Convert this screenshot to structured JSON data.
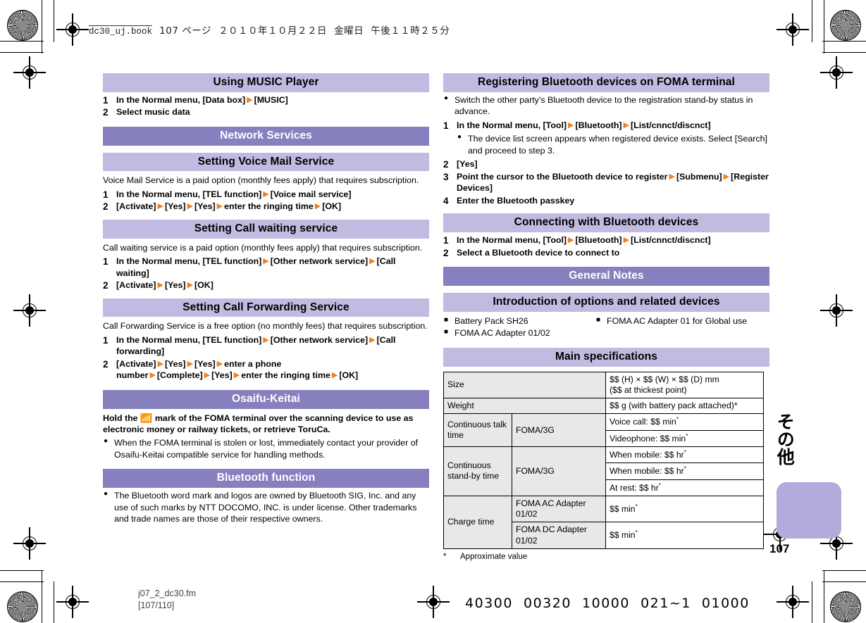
{
  "running_header": {
    "file": "dc30_uj.book",
    "page_label": "107 ページ",
    "date": "２０１０年１０月２２日",
    "weekday": "金曜日",
    "time": "午後１１時２５分"
  },
  "colors": {
    "header_light": "#c2bae0",
    "header_dark": "#8780bf",
    "arrow_orange": "#f08020",
    "table_label_bg": "#e8e8e8",
    "thumb_tab": "#b4aadc"
  },
  "left_column": {
    "music": {
      "heading": "Using MUSIC Player",
      "steps": [
        {
          "num": "1",
          "parts": [
            "In the Normal menu, [Data box]",
            "[MUSIC]"
          ]
        },
        {
          "num": "2",
          "parts": [
            "Select music data"
          ]
        }
      ]
    },
    "network_services_heading": "Network Services",
    "voice_mail": {
      "heading": "Setting Voice Mail Service",
      "note": "Voice Mail Service is a paid option (monthly fees apply) that requires subscription.",
      "steps": [
        {
          "num": "1",
          "parts": [
            "In the Normal menu, [TEL function]",
            "[Voice mail service]"
          ]
        },
        {
          "num": "2",
          "parts": [
            "[Activate]",
            "[Yes]",
            "[Yes]",
            "enter the ringing time",
            "[OK]"
          ]
        }
      ]
    },
    "call_waiting": {
      "heading": "Setting Call waiting service",
      "note": "Call waiting service is a paid option (monthly fees apply) that requires subscription.",
      "steps": [
        {
          "num": "1",
          "parts": [
            "In the Normal menu, [TEL function]",
            "[Other network service]",
            "[Call waiting]"
          ]
        },
        {
          "num": "2",
          "parts": [
            "[Activate]",
            "[Yes]",
            "[OK]"
          ]
        }
      ]
    },
    "call_forwarding": {
      "heading": "Setting Call Forwarding Service",
      "note": "Call Forwarding Service is a free option (no monthly fees) that requires subscription.",
      "steps": [
        {
          "num": "1",
          "parts": [
            "In the Normal menu, [TEL function]",
            "[Other network service]",
            "[Call forwarding]"
          ]
        },
        {
          "num": "2",
          "parts": [
            "[Activate]",
            "[Yes]",
            "[Yes]",
            "enter a phone number",
            "[Complete]",
            "[Yes]",
            "enter the ringing time",
            "[OK]"
          ]
        }
      ]
    },
    "osaifu": {
      "heading": "Osaifu-Keitai",
      "lead_before": "Hold the",
      "mark_icon": "felica-mark-icon",
      "lead_after": "mark of the FOMA terminal over the scanning device to use as electronic money or railway tickets, or retrieve ToruCa.",
      "bullets": [
        "When the FOMA terminal is stolen or lost, immediately contact your provider of Osaifu-Keitai compatible service for handling methods."
      ]
    },
    "bluetooth": {
      "heading": "Bluetooth function",
      "bullets": [
        "The Bluetooth word mark and logos are owned by Bluetooth SIG, Inc. and any use of such marks by NTT DOCOMO, INC. is under license. Other trademarks and trade names are those of their respective owners."
      ]
    }
  },
  "right_column": {
    "registering": {
      "heading": "Registering Bluetooth devices on FOMA terminal",
      "bullets": [
        "Switch the other party’s Bluetooth device to the registration stand-by status in advance."
      ],
      "steps": [
        {
          "num": "1",
          "parts": [
            "In the Normal menu, [Tool]",
            "[Bluetooth]",
            "[List/cnnct/discnct]"
          ],
          "subbullets": [
            "The device list screen appears when registered device exists. Select [Search] and proceed to step 3."
          ]
        },
        {
          "num": "2",
          "parts": [
            "[Yes]"
          ]
        },
        {
          "num": "3",
          "parts": [
            "Point the cursor to the Bluetooth device to register",
            "[Submenu]",
            "[Register Devices]"
          ]
        },
        {
          "num": "4",
          "parts": [
            "Enter the Bluetooth passkey"
          ]
        }
      ]
    },
    "connecting": {
      "heading": "Connecting with Bluetooth devices",
      "steps": [
        {
          "num": "1",
          "parts": [
            "In the Normal menu, [Tool]",
            "[Bluetooth]",
            "[List/cnnct/discnct]"
          ]
        },
        {
          "num": "2",
          "parts": [
            "Select a Bluetooth device to connect to"
          ]
        }
      ]
    },
    "general_notes_heading": "General Notes",
    "options": {
      "heading": "Introduction of options and related devices",
      "col1": [
        "Battery Pack SH26",
        "FOMA AC Adapter 01/02"
      ],
      "col2": [
        "FOMA AC Adapter 01 for Global use"
      ]
    },
    "specs": {
      "heading": "Main specifications",
      "rows": [
        {
          "label": "Size",
          "sub": null,
          "values": [
            "$$ (H) × $$ (W) × $$ (D) mm",
            "($$ at thickest point)"
          ]
        },
        {
          "label": "Weight",
          "sub": null,
          "values": [
            "$$ g (with battery pack attached)*"
          ]
        },
        {
          "label": "Continuous talk time",
          "sub": "FOMA/3G",
          "values": [
            "Voice call: $$ min*",
            "Videophone: $$ min*"
          ]
        },
        {
          "label": "Continuous stand-by time",
          "sub": "FOMA/3G",
          "values": [
            "When mobile: $$ hr*",
            "When mobile: $$ hr*",
            "At rest: $$ hr*"
          ]
        },
        {
          "label": "Charge time",
          "sub": "FOMA AC Adapter 01/02",
          "values": [
            "$$ min*"
          ]
        },
        {
          "label": "",
          "sub": "FOMA DC Adapter 01/02",
          "values": [
            "$$ min*"
          ]
        }
      ],
      "footnote_star": "*",
      "footnote_text": "Approximate value"
    }
  },
  "margin": {
    "vertical_tab_text": "その他",
    "page_number": "107"
  },
  "footer": {
    "filename": "j07_2_dc30.fm",
    "pagination": "[107/110]",
    "barcode": "40300  00320  10000  021~1  01000"
  }
}
